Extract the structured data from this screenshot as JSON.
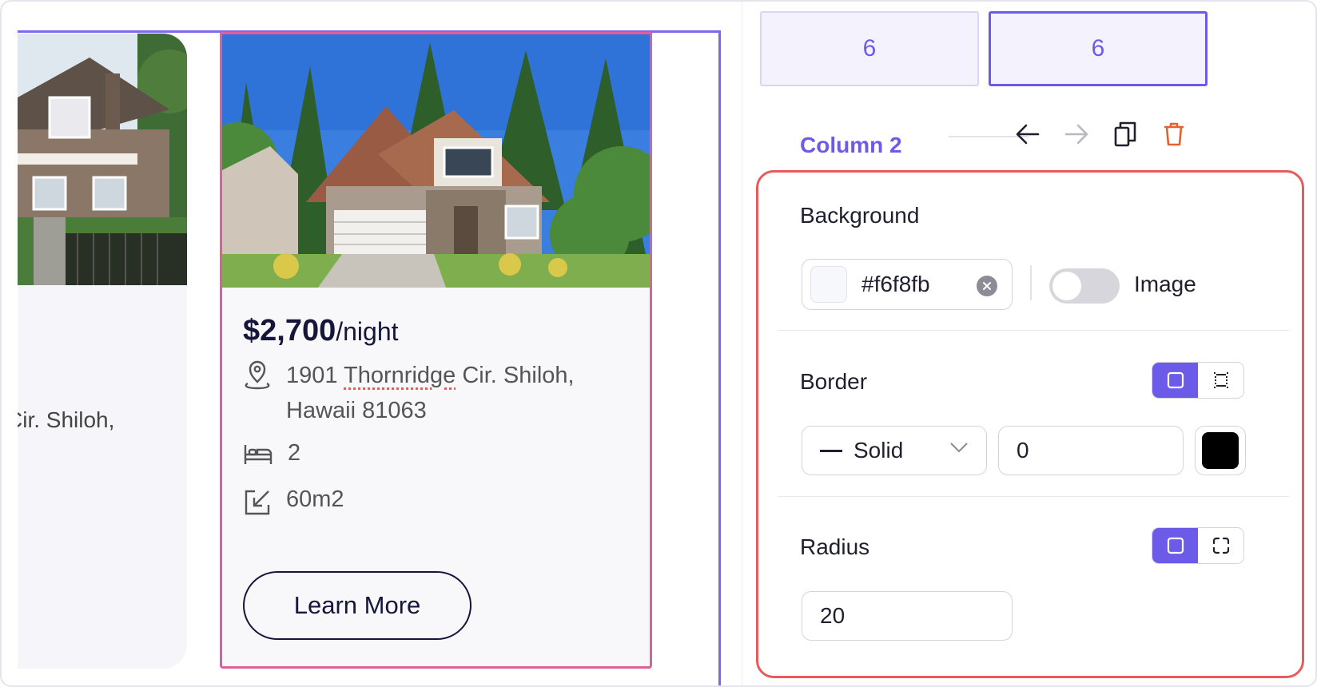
{
  "canvas": {
    "left_card": {
      "address_fragment": "Cir. Shiloh,"
    },
    "right_card": {
      "price": "$2,700",
      "price_unit": "/night",
      "address_line1_pre": "1901 ",
      "address_line1_word": "Thornridge",
      "address_line1_post": " Cir. Shiloh,",
      "address_line2": "Hawaii 81063",
      "bedrooms": "2",
      "area": "60m2",
      "button_label": "Learn More"
    }
  },
  "panel": {
    "columns": [
      {
        "value": "6"
      },
      {
        "value": "6",
        "active": true
      }
    ],
    "column_title": "Column 2",
    "background": {
      "label": "Background",
      "color_value": "#f6f8fb",
      "color_hex_text": "#f6f8fb",
      "image_toggle_label": "Image",
      "image_enabled": false
    },
    "border": {
      "label": "Border",
      "style": "Solid",
      "width": "0",
      "color": "#000000"
    },
    "radius": {
      "label": "Radius",
      "value": "20"
    }
  },
  "colors": {
    "accent": "#6b5be8",
    "selection_pink": "#e05f9b",
    "highlight_red": "#ea5a5a",
    "delete_orange": "#e8602c"
  },
  "icons": [
    "location-pin-icon",
    "bed-icon",
    "resize-icon",
    "arrow-left-icon",
    "arrow-right-icon",
    "duplicate-icon",
    "trash-icon",
    "clear-icon",
    "chevron-down-icon",
    "border-all-icon",
    "border-individual-icon",
    "radius-all-icon",
    "radius-individual-icon"
  ]
}
